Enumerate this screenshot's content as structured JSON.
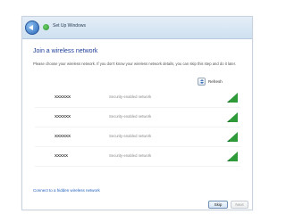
{
  "window": {
    "title": "Set Up Windows"
  },
  "page": {
    "heading": "Join a wireless network",
    "instructions": "Please choose your wireless network. If you don't know your wireless network details, you can skip this step and do it later."
  },
  "toolbar": {
    "refresh_label": "Refresh"
  },
  "networks": [
    {
      "ssid": "XXXXXX",
      "security": "Security-enabled network",
      "signal": "strong"
    },
    {
      "ssid": "XXXXXX",
      "security": "Security-enabled network",
      "signal": "strong"
    },
    {
      "ssid": "XXXXXX",
      "security": "Security-enabled network",
      "signal": "strong"
    },
    {
      "ssid": "XXXXX",
      "security": "Security-enabled network",
      "signal": "strong"
    }
  ],
  "links": {
    "hidden_network": "Connect to a hidden wireless network"
  },
  "buttons": {
    "next": "Skip",
    "cancel": "Next"
  },
  "colors": {
    "signal": "#2e9a3a",
    "accent": "#1e3f9a",
    "link": "#1f5fbf"
  },
  "icons": {
    "back": "back-arrow-icon",
    "wizard": "network-setup-icon",
    "refresh": "refresh-icon",
    "signal": "wireless-signal-icon"
  }
}
